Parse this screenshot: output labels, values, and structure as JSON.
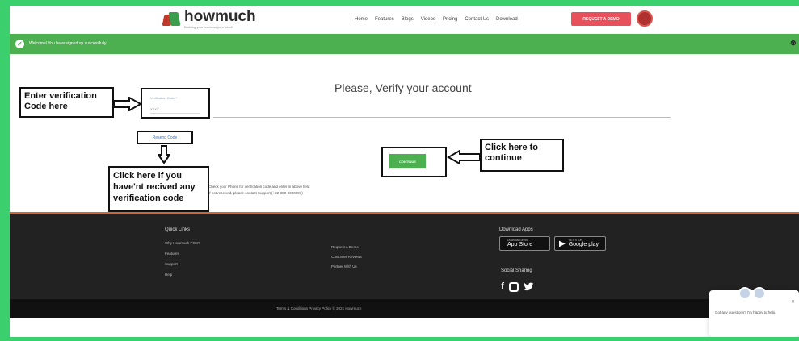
{
  "header": {
    "logo_text": "howmuch",
    "logo_tagline": "Building your business your mind!",
    "nav": [
      "Home",
      "Features",
      "Blogs",
      "Videos",
      "Pricing",
      "Contact Us",
      "Download"
    ],
    "demo_button": "REQUEST A DEMO"
  },
  "notification": {
    "text": "Welcome! You have signed up successfully",
    "close": "⊗"
  },
  "verify": {
    "title": "Please, Verify your account",
    "code_label": "Verification Code *",
    "code_placeholder": "XXXX",
    "resend_label": "Resend Code",
    "continue_label": "CONTINUE",
    "help_line1": "Check your Phone for verification code and enter in above field",
    "help_line2": "If not received, please contact Support (+92-300-0000001)"
  },
  "annotations": {
    "enter_code": "Enter verification Code here",
    "click_continue": "Click here to continue",
    "resend_hint": "Click here if you have'nt recived any verification code"
  },
  "footer": {
    "quick_links_title": "Quick Links",
    "quick_links": [
      "Why Howmuch POS?",
      "Features",
      "Support",
      "Help"
    ],
    "mid_links": [
      "Request a Demo",
      "Customer Reviews",
      "Partner With Us"
    ],
    "download_title": "Download Apps",
    "app_store_small": "Download on the",
    "app_store_big": "App Store",
    "google_play_small": "GET IT ON",
    "google_play_big": "Google play",
    "social_title": "Social Sharing",
    "copyright": "Terms & Conditions   Privacy Policy   © 2021 Howmuch"
  },
  "chat": {
    "message": "Got any questions? I'm happy to help."
  },
  "colors": {
    "page_bg": "#3ccf6e",
    "success": "#4caf50",
    "demo_button": "#e8505b",
    "footer": "#222222"
  }
}
